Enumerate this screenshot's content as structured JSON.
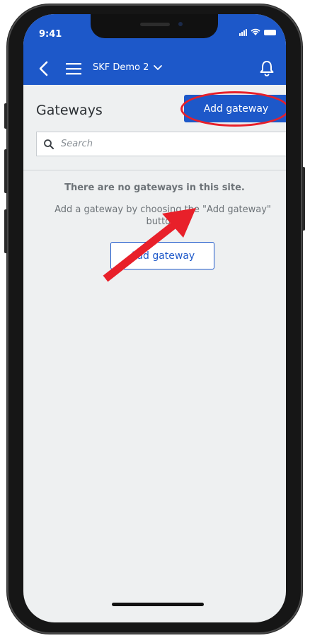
{
  "status_bar": {
    "time": "9:41"
  },
  "nav": {
    "site_name": "SKF Demo 2"
  },
  "page": {
    "title": "Gateways",
    "add_button_label": "Add gateway",
    "search_placeholder": "Search"
  },
  "empty_state": {
    "title": "There are no gateways in this site.",
    "description": "Add a gateway by choosing the \"Add gateway\" button.",
    "button_label": "Add gateway"
  },
  "colors": {
    "brand_blue": "#1d58c9",
    "annotation_red": "#e8202a",
    "background": "#eef0f1"
  },
  "icons": [
    "back-chevron-icon",
    "hamburger-menu-icon",
    "chevron-down-icon",
    "bell-icon",
    "search-icon",
    "wifi-icon",
    "signal-icon",
    "battery-icon"
  ]
}
